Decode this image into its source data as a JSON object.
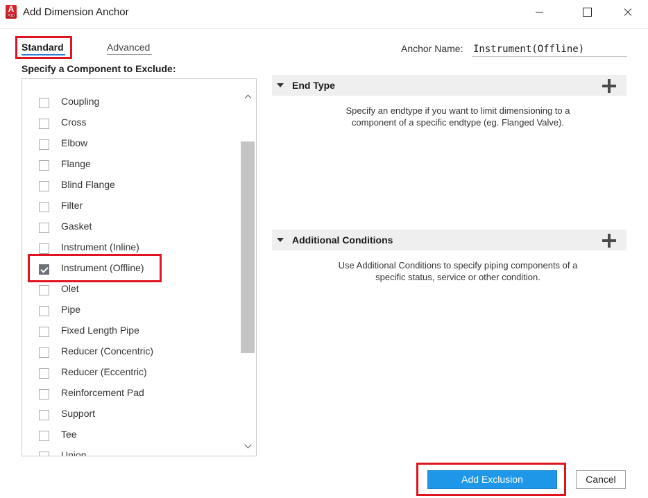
{
  "window": {
    "app_icon_letter": "A",
    "app_icon_sub": "P3D",
    "title": "Add Dimension Anchor"
  },
  "tabs": [
    {
      "label": "Standard",
      "selected": true
    },
    {
      "label": "Advanced",
      "selected": false
    }
  ],
  "anchor": {
    "label": "Anchor Name:",
    "value": "Instrument(Offline)"
  },
  "components": {
    "label": "Specify a Component to Exclude:",
    "items": [
      {
        "label": "Coupling",
        "checked": false
      },
      {
        "label": "Cross",
        "checked": false
      },
      {
        "label": "Elbow",
        "checked": false
      },
      {
        "label": "Flange",
        "checked": false
      },
      {
        "label": "Blind Flange",
        "checked": false
      },
      {
        "label": "Filter",
        "checked": false
      },
      {
        "label": "Gasket",
        "checked": false
      },
      {
        "label": "Instrument (Inline)",
        "checked": false
      },
      {
        "label": "Instrument (Offline)",
        "checked": true
      },
      {
        "label": "Olet",
        "checked": false
      },
      {
        "label": "Pipe",
        "checked": false
      },
      {
        "label": "Fixed Length Pipe",
        "checked": false
      },
      {
        "label": "Reducer (Concentric)",
        "checked": false
      },
      {
        "label": "Reducer (Eccentric)",
        "checked": false
      },
      {
        "label": "Reinforcement Pad",
        "checked": false
      },
      {
        "label": "Support",
        "checked": false
      },
      {
        "label": "Tee",
        "checked": false
      },
      {
        "label": "Union",
        "checked": false
      }
    ]
  },
  "end_type": {
    "title": "End Type",
    "description_line1": "Specify an endtype if you want to limit dimensioning to a",
    "description_line2": "component of a specific endtype (eg. Flanged Valve)."
  },
  "additional_conditions": {
    "title": "Additional Conditions",
    "description_line1": "Use Additional Conditions to specify piping components of a",
    "description_line2": "specific status, service or other condition."
  },
  "buttons": {
    "add_exclusion": "Add Exclusion",
    "cancel": "Cancel"
  },
  "colors": {
    "accent": "#1f97e8",
    "highlight": "#e0141e",
    "tab_underline": "#2a7fd4"
  }
}
